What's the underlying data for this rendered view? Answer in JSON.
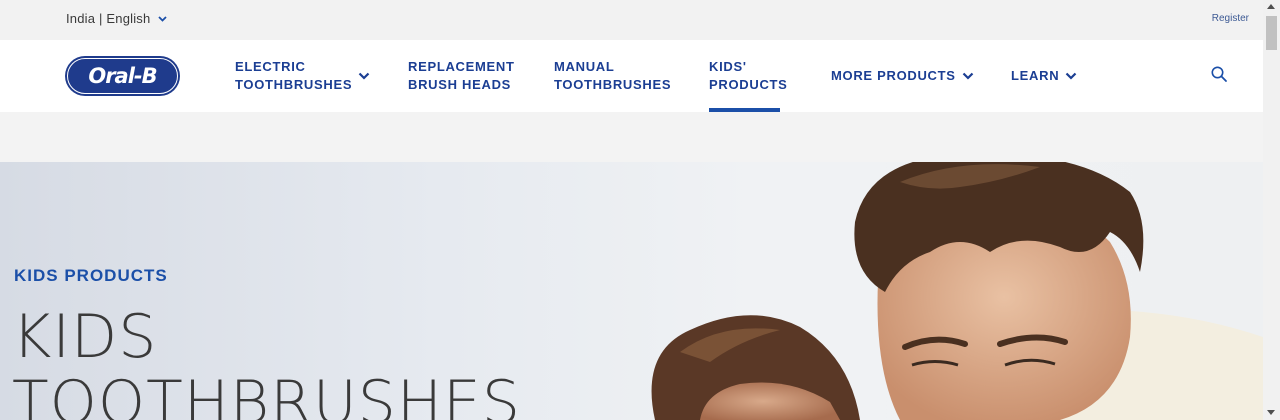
{
  "topbar": {
    "locale": "India | English",
    "register": "Register",
    "locale_icon": "chevron-down-icon"
  },
  "brand": {
    "logo_text": "Oral-B",
    "color": "#1f3b8c"
  },
  "nav": {
    "items": [
      {
        "label": "ELECTRIC\nTOOTHBRUSHES",
        "has_dropdown": true
      },
      {
        "label": "REPLACEMENT\nBRUSH HEADS",
        "has_dropdown": false
      },
      {
        "label": "MANUAL\nTOOTHBRUSHES",
        "has_dropdown": false
      },
      {
        "label": "KIDS'\nPRODUCTS",
        "has_dropdown": false,
        "active": true
      },
      {
        "label": "MORE PRODUCTS",
        "has_dropdown": true
      },
      {
        "label": "LEARN",
        "has_dropdown": true
      }
    ],
    "search_icon": "search-icon",
    "accent": "#1b4fa8"
  },
  "hero": {
    "eyebrow": "KIDS PRODUCTS",
    "headline": "KIDS\nTOOTHBRUSHES"
  }
}
